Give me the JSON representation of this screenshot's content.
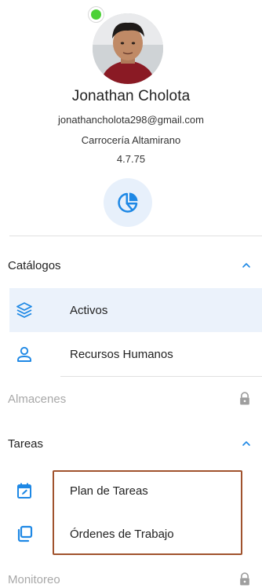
{
  "profile": {
    "name": "Jonathan Cholota",
    "email": "jonathancholota298@gmail.com",
    "company": "Carrocería Altamirano",
    "version": "4.7.75",
    "status_color": "#4cd137"
  },
  "accent_color": "#1e88e5",
  "sections": {
    "catalogos": {
      "label": "Catálogos",
      "expanded": true,
      "items": [
        {
          "label": "Activos",
          "icon": "layers-icon",
          "active": true
        },
        {
          "label": "Recursos Humanos",
          "icon": "person-icon",
          "active": false
        }
      ]
    },
    "almacenes": {
      "label": "Almacenes",
      "locked": true,
      "icon": "lock-icon"
    },
    "tareas": {
      "label": "Tareas",
      "expanded": true,
      "items": [
        {
          "label": "Plan de Tareas",
          "icon": "calendar-edit-icon",
          "active": false
        },
        {
          "label": "Órdenes de Trabajo",
          "icon": "copy-icon",
          "active": false
        }
      ]
    },
    "monitoreo": {
      "label": "Monitoreo",
      "locked": true,
      "icon": "lock-icon"
    }
  }
}
